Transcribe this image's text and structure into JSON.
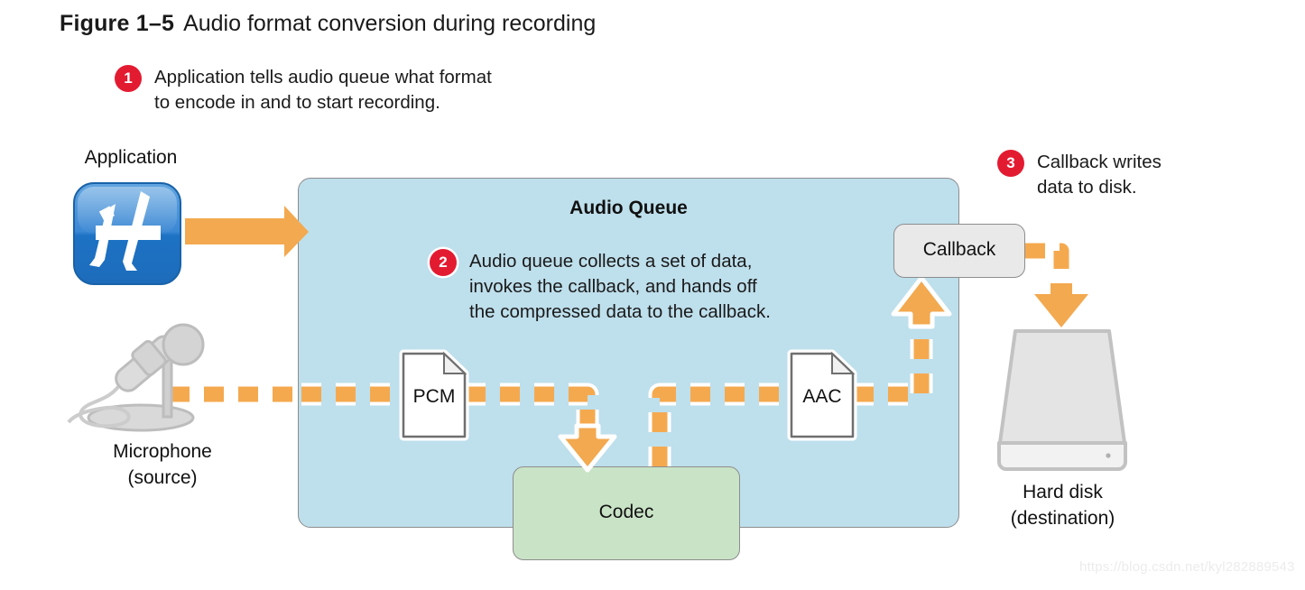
{
  "figure": {
    "label": "Figure 1–5",
    "caption": "Audio format conversion during recording"
  },
  "steps": [
    {
      "number": "1",
      "text": "Application tells audio queue what format\nto encode in and to start recording."
    },
    {
      "number": "2",
      "text": "Audio queue collects a set of data,\ninvokes the callback, and hands off\nthe compressed data to the callback."
    },
    {
      "number": "3",
      "text": "Callback writes\ndata to disk."
    }
  ],
  "nodes": {
    "application_label": "Application",
    "audio_queue_title": "Audio Queue",
    "microphone_label": "Microphone\n(source)",
    "harddisk_label": "Hard disk\n(destination)",
    "codec_label": "Codec",
    "callback_label": "Callback",
    "pcm_file_label": "PCM",
    "aac_file_label": "AAC"
  },
  "watermark": "https://blog.csdn.net/kyl282889543",
  "colors": {
    "badge_red": "#e31b31",
    "audio_queue_fill": "#bedfec",
    "codec_fill": "#c9e3c6",
    "callback_fill": "#e9e9e9",
    "flow_orange": "#f5a94f",
    "arrow_orange": "#f3a94f",
    "box_border": "#8d8d8d",
    "app_icon_blue": "#1d72c4",
    "device_grey": "#d7d7d7"
  },
  "icons": {
    "application": "app-store-icon",
    "microphone": "microphone-icon",
    "harddisk": "hard-disk-icon",
    "pcm_file": "file-document-icon",
    "aac_file": "file-document-icon"
  }
}
